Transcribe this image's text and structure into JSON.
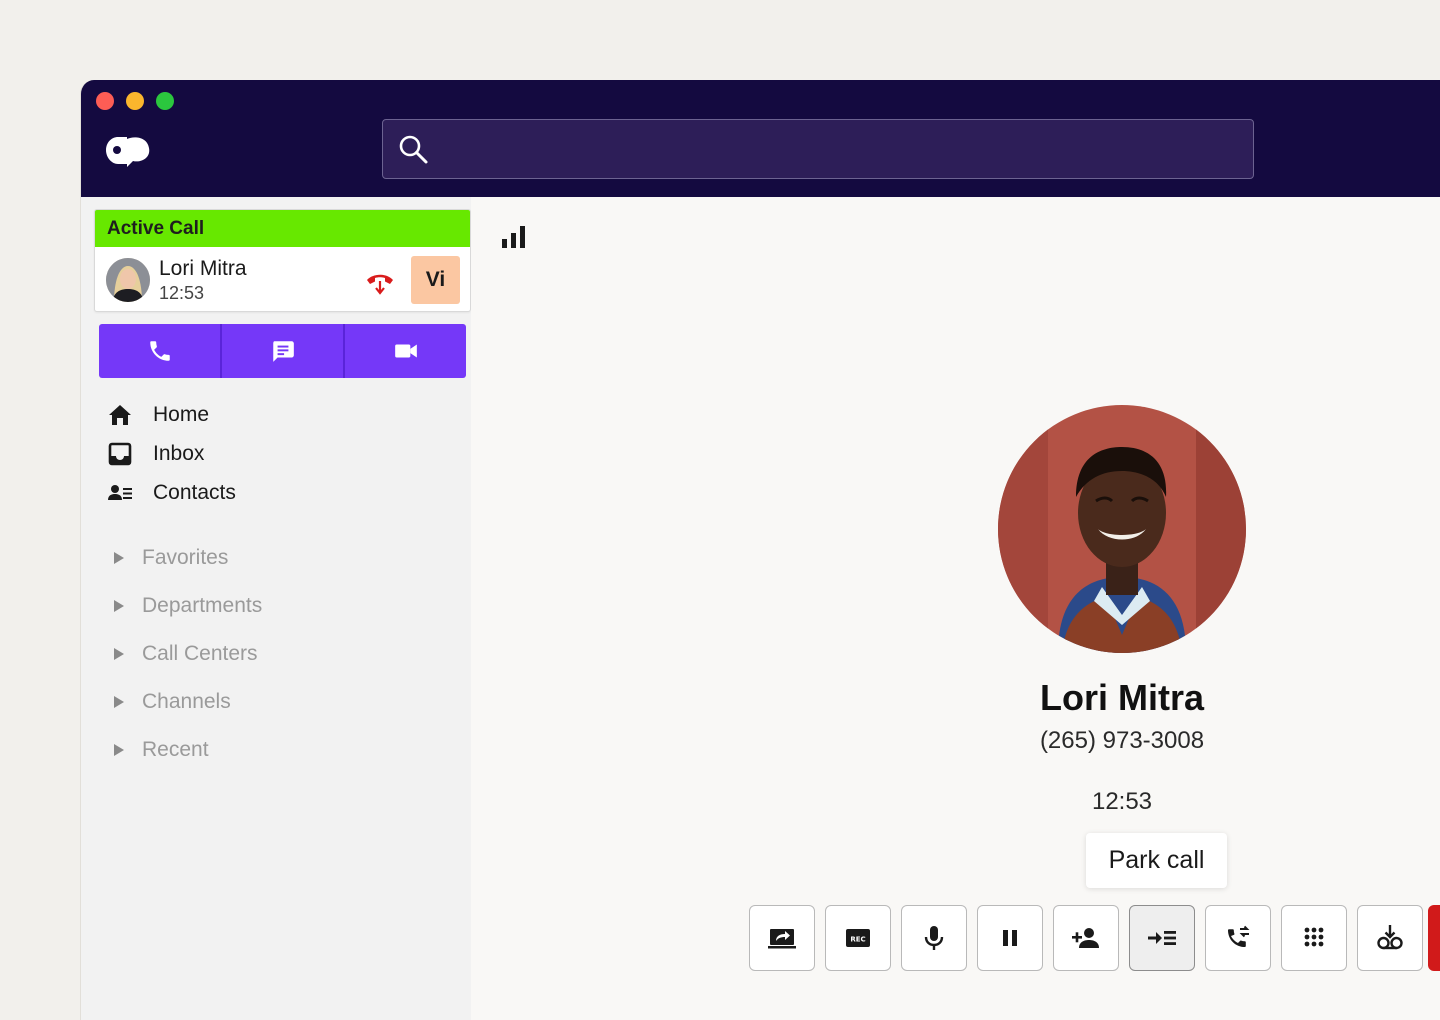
{
  "search": {
    "placeholder": ""
  },
  "active_call": {
    "header": "Active Call",
    "caller_name": "Lori Mitra",
    "duration": "12:53",
    "badge": "Vi"
  },
  "nav": [
    {
      "label": "Home",
      "icon": "home-icon"
    },
    {
      "label": "Inbox",
      "icon": "inbox-icon"
    },
    {
      "label": "Contacts",
      "icon": "contacts-icon"
    }
  ],
  "groups": [
    {
      "label": "Favorites"
    },
    {
      "label": "Departments"
    },
    {
      "label": "Call Centers"
    },
    {
      "label": "Channels"
    },
    {
      "label": "Recent"
    }
  ],
  "contact": {
    "name": "Lori Mitra",
    "phone": "(265) 973-3008",
    "timer": "12:53"
  },
  "tooltip": "Park call",
  "controls": [
    {
      "icon": "share-screen-icon"
    },
    {
      "icon": "record-icon",
      "label": "REC"
    },
    {
      "icon": "microphone-icon"
    },
    {
      "icon": "pause-icon"
    },
    {
      "icon": "add-person-icon"
    },
    {
      "icon": "park-call-icon",
      "active": true
    },
    {
      "icon": "transfer-call-icon"
    },
    {
      "icon": "dialpad-icon"
    },
    {
      "icon": "voicemail-drop-icon"
    }
  ],
  "colors": {
    "titlebar": "#140a40",
    "search_bg": "#2d1e58",
    "active_green": "#67e800",
    "action_purple": "#7538f8",
    "badge_peach": "#fbc7a2",
    "hangup_red": "#d11a1a"
  }
}
